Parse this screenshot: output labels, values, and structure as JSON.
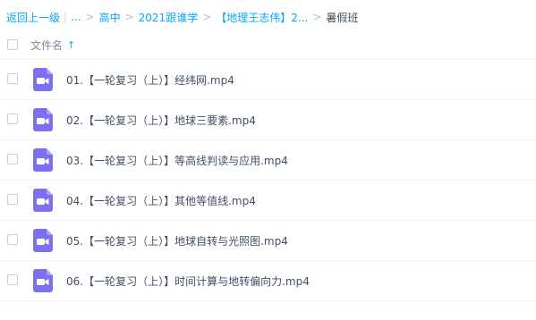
{
  "breadcrumb": {
    "back": "返回上一级",
    "bar": "|",
    "ellipsis": "...",
    "sep": ">",
    "items": [
      "高中",
      "2021跟谁学",
      "【地理王志伟】2..."
    ],
    "current": "暑假班"
  },
  "header": {
    "column_label": "文件名",
    "sort_icon": "arrow-up-icon"
  },
  "files": [
    {
      "name": "01.【一轮复习（上）】经纬网.mp4",
      "icon": "video-file-icon"
    },
    {
      "name": "02.【一轮复习（上）】地球三要素.mp4",
      "icon": "video-file-icon"
    },
    {
      "name": "03.【一轮复习（上）】等高线判读与应用.mp4",
      "icon": "video-file-icon"
    },
    {
      "name": "04.【一轮复习（上）】其他等值线.mp4",
      "icon": "video-file-icon"
    },
    {
      "name": "05.【一轮复习（上）】地球自转与光照图.mp4",
      "icon": "video-file-icon"
    },
    {
      "name": "06.【一轮复习（上）】时间计算与地转偏向力.mp4",
      "icon": "video-file-icon"
    }
  ],
  "colors": {
    "accent": "#06a7ff",
    "video_icon": "#7b6ff2"
  }
}
